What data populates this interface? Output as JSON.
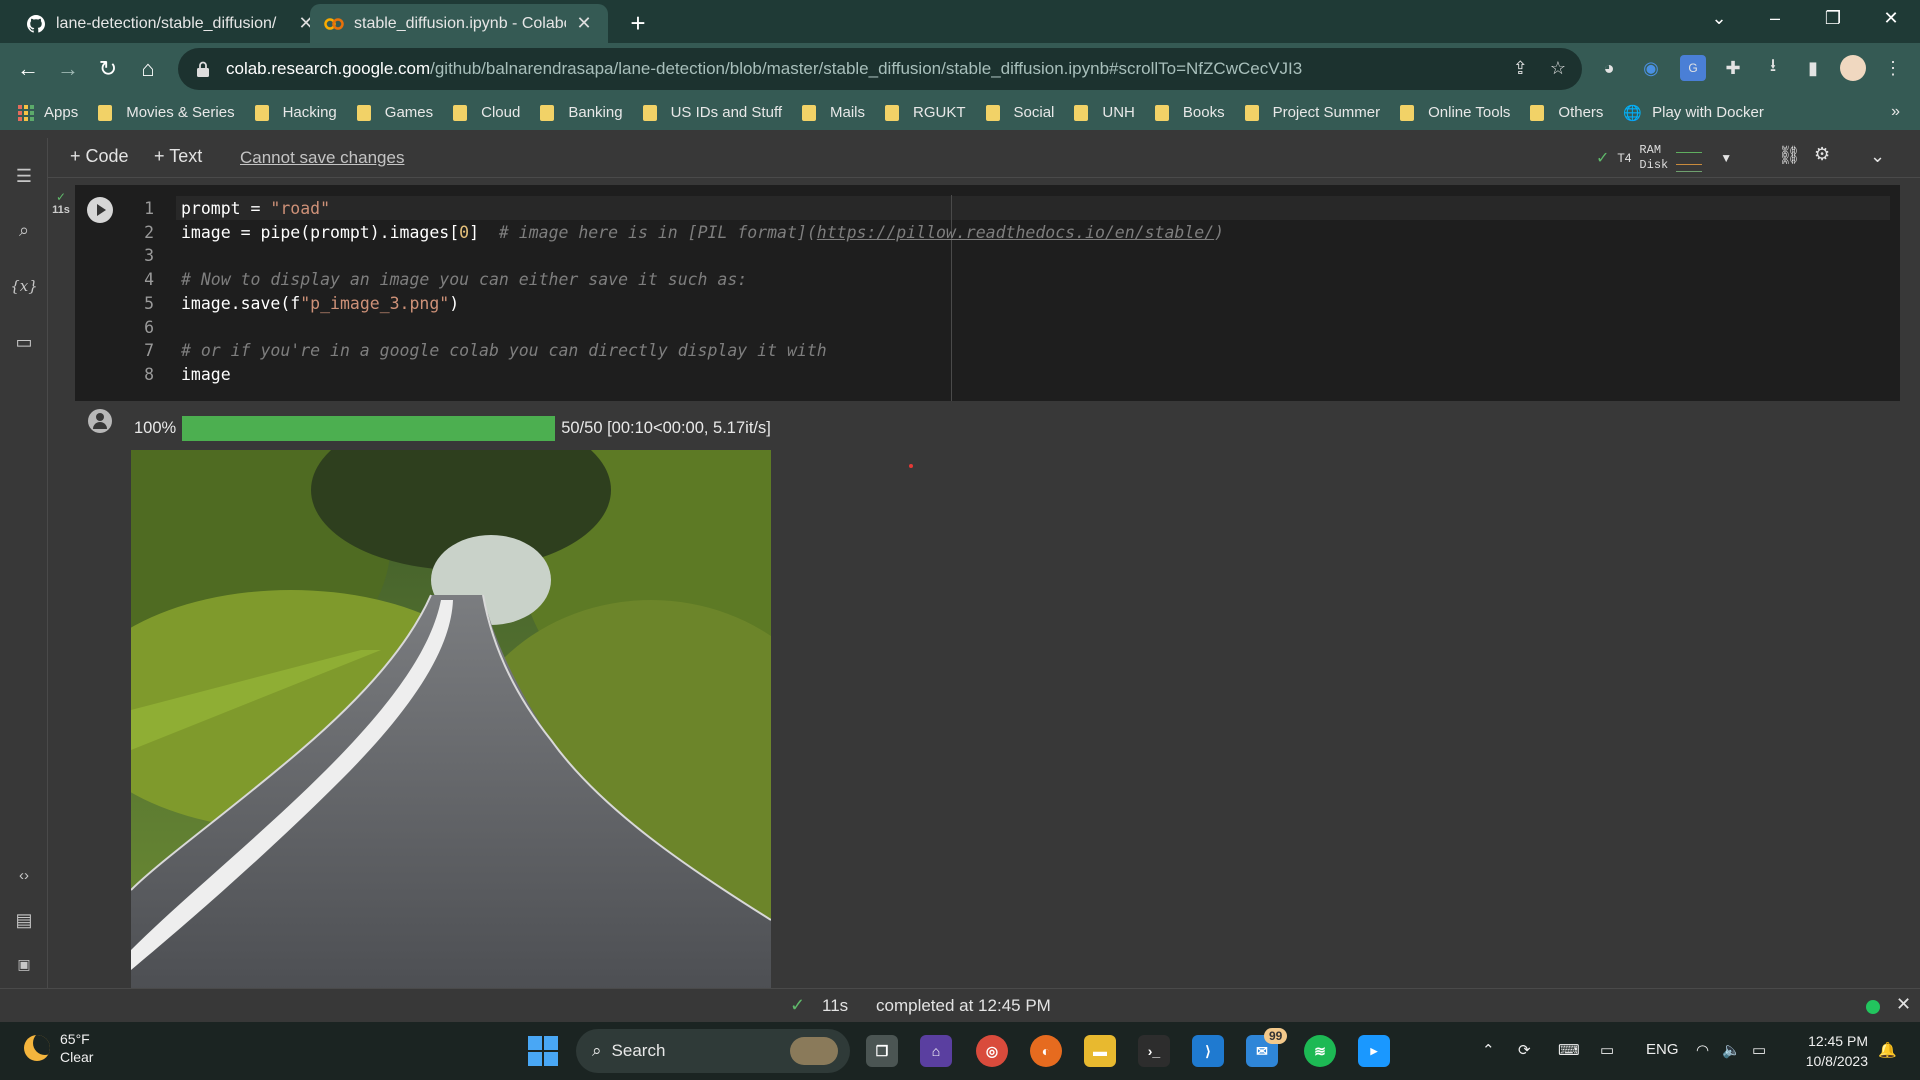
{
  "browser": {
    "tabs": [
      {
        "title": "lane-detection/stable_diffusion/",
        "icon": "github-icon",
        "active": false
      },
      {
        "title": "stable_diffusion.ipynb - Colabora",
        "icon": "colab-icon",
        "active": true
      }
    ],
    "url_host": "colab.research.google.com",
    "url_path": "/github/balnarendrasapa/lane-detection/blob/master/stable_diffusion/stable_diffusion.ipynb#scrollTo=NfZCwCecVJI3",
    "bookmarks": [
      "Apps",
      "Movies & Series",
      "Hacking",
      "Games",
      "Cloud",
      "Banking",
      "US IDs and Stuff",
      "Mails",
      "RGUKT",
      "Social",
      "UNH",
      "Books",
      "Project Summer",
      "Online Tools",
      "Others",
      "Play with Docker"
    ],
    "bookmarks_more": "»"
  },
  "colab": {
    "add_code": "+ Code",
    "add_text": "+ Text",
    "cannot_save": "Cannot save changes",
    "runtime_check": "✓",
    "runtime_gpu": "T4",
    "ram_label": "RAM",
    "disk_label": "Disk"
  },
  "cell": {
    "exec_time": "11s",
    "lines": [
      {
        "n": "1"
      },
      {
        "n": "2"
      },
      {
        "n": "3"
      },
      {
        "n": "4"
      },
      {
        "n": "5"
      },
      {
        "n": "6"
      },
      {
        "n": "7"
      },
      {
        "n": "8"
      }
    ],
    "code": {
      "l1_a": "prompt",
      "l1_b": " = ",
      "l1_c": "\"road\"",
      "l2_a": "image = pipe(prompt).images[",
      "l2_b": "0",
      "l2_c": "]  ",
      "l2_d": "# image here is in [PIL format](",
      "l2_e": "https://pillow.readthedocs.io/en/stable/",
      "l2_f": ")",
      "l4": "# Now to display an image you can either save it such as:",
      "l5_a": "image.save(f",
      "l5_b": "\"p_image_3.png\"",
      "l5_c": ")",
      "l7": "# or if you're in a google colab you can directly display it with",
      "l8": "image"
    }
  },
  "output": {
    "percent": "100%",
    "progress_fraction": 1.0,
    "progress_stats": "50/50 [00:10<00:00, 5.17it/s]"
  },
  "status": {
    "check": "✓",
    "duration": "11s",
    "completed": "completed at 12:45 PM"
  },
  "taskbar": {
    "temp": "65°F",
    "weather": "Clear",
    "search": "Search",
    "mail_badge": "99",
    "lang": "ENG",
    "time": "12:45 PM",
    "date": "10/8/2023"
  },
  "colors": {
    "accent_green": "#4caf50",
    "titlebar": "#1f3a36",
    "toolbar": "#355a54"
  }
}
